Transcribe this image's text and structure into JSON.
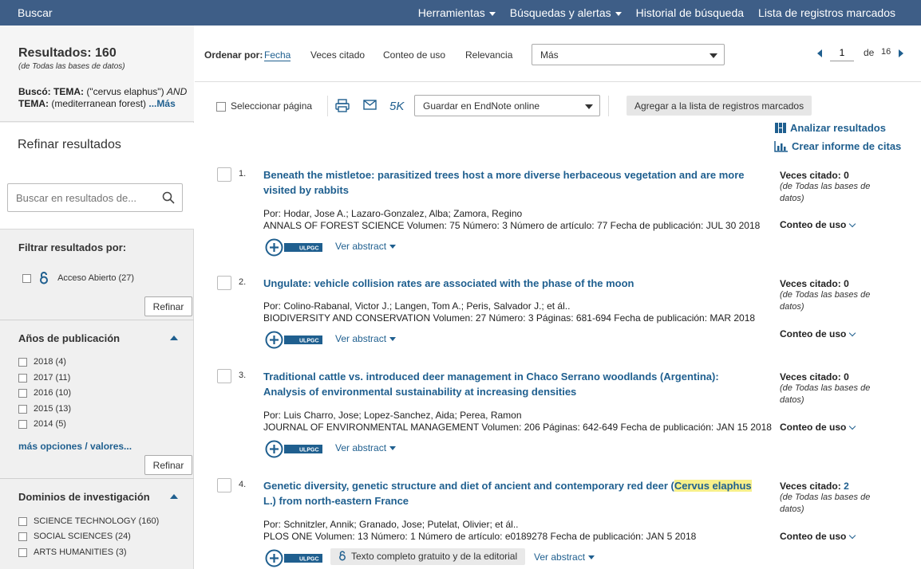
{
  "topbar": {
    "search": "Buscar",
    "nav": [
      {
        "label": "Herramientas",
        "caret": true
      },
      {
        "label": "Búsquedas y alertas",
        "caret": true
      },
      {
        "label": "Historial de búsqueda",
        "caret": false
      },
      {
        "label": "Lista de registros marcados",
        "caret": false
      }
    ]
  },
  "sidebar": {
    "results_label": "Resultados: 160",
    "results_sub": "(de Todas las bases de datos)",
    "query_prefix1": "Buscó: TEMA:",
    "query_val1": " (\"cervus elaphus\") ",
    "query_and": "AND",
    "query_prefix2": "TEMA:",
    "query_val2": " (mediterranean forest) ",
    "query_more": "...Más",
    "refine_title": "Refinar resultados",
    "search_placeholder": "Buscar en resultados de...",
    "filter_title": "Filtrar resultados por:",
    "open_access": "Acceso Abierto (27)",
    "refine_btn": "Refinar",
    "years_title": "Años de publicación",
    "years": [
      "2018 (4)",
      "2017 (11)",
      "2016 (10)",
      "2015 (13)",
      "2014 (5)"
    ],
    "more_options": "más opciones / valores...",
    "domains_title": "Dominios de investigación",
    "domains": [
      "SCIENCE TECHNOLOGY (160)",
      "SOCIAL SCIENCES (24)",
      "ARTS HUMANITIES (3)"
    ]
  },
  "sortbar": {
    "label": "Ordenar por:",
    "options": [
      "Fecha",
      "Veces citado",
      "Conteo de uso",
      "Relevancia"
    ],
    "more_select": "Más",
    "page_current": "1",
    "page_of": "de",
    "page_total": "16"
  },
  "actions": {
    "select_page": "Seleccionar página",
    "k5": "5K",
    "endnote": "Guardar en EndNote online",
    "add_marked": "Agregar a la lista de registros marcados",
    "analyze": "Analizar resultados",
    "citation_report": "Crear informe de citas"
  },
  "common": {
    "cited_label": "Veces citado:",
    "cited_sub": "(de Todas las bases de datos)",
    "usage": "Conteo de uso",
    "abstract": "Ver abstract",
    "ulpgc": "ULPGC"
  },
  "records": [
    {
      "num": "1.",
      "title": "Beneath the mistletoe: parasitized trees host a more diverse herbaceous vegetation and are more visited by rabbits",
      "authors": "Por: Hodar, Jose A.; Lazaro-Gonzalez, Alba; Zamora, Regino",
      "journal": "ANNALS OF FOREST SCIENCE",
      "details": "  Volumen: 75   Número: 3    Número de artículo: 77   Fecha de publicación: JUL 30 2018",
      "cited": "0"
    },
    {
      "num": "2.",
      "title": "Ungulate: vehicle collision rates are associated with the phase of the moon",
      "authors": "Por: Colino-Rabanal, Victor J.; Langen, Tom A.; Peris, Salvador J.; et ál..",
      "journal": "BIODIVERSITY AND CONSERVATION",
      "details": "  Volumen: 27   Número: 3   Páginas: 681-694   Fecha de publicación: MAR 2018",
      "cited": "0"
    },
    {
      "num": "3.",
      "title": "Traditional cattle vs. introduced deer management in Chaco Serrano woodlands (Argentina): Analysis of environmental sustainability at increasing densities",
      "authors": "Por: Luis Charro, Jose; Lopez-Sanchez, Aida; Perea, Ramon",
      "journal": "JOURNAL OF ENVIRONMENTAL MANAGEMENT",
      "details": "  Volumen: 206   Páginas: 642-649   Fecha de publicación: JAN 15 2018",
      "cited": "0"
    },
    {
      "num": "4.",
      "title_pre": "Genetic diversity, genetic structure and diet of ancient and contemporary red deer (",
      "title_hl": "Cervus elaphus",
      "title_post": " L.) from north-eastern France",
      "authors": "Por: Schnitzler, Annik; Granado, Jose; Putelat, Olivier; et ál..",
      "journal": "PLOS ONE",
      "details": "  Volumen: 13   Número: 1    Número de artículo: e0189278   Fecha de publicación: JAN 5 2018",
      "cited": "2",
      "fulltext": "Texto completo gratuito y de la editorial"
    }
  ],
  "colors": {
    "topbar": "#3e5e87",
    "link": "#1f5f8f",
    "highlight": "#f7f08a"
  }
}
